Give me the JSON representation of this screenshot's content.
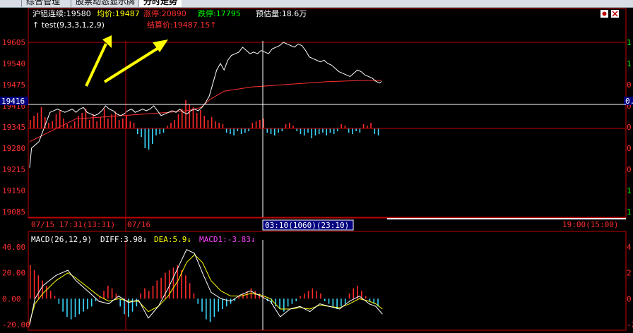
{
  "tabs": [
    {
      "label": "综合管理"
    },
    {
      "label": "股票动态显示牌"
    },
    {
      "label": "分时走势"
    }
  ],
  "info_bar": {
    "name": "沪铝连续:19580",
    "avg_label": "均价:19487",
    "up_limit": "涨停:20890",
    "down_limit": "跌停:17795",
    "est_vol": "预估量:18.6万",
    "indicator": "↑ test(9,3,3,1,2,9)",
    "settle": "结算价:19487.15↑",
    "corner_icon_a": "gear-icon",
    "corner_icon_b": "close-icon"
  },
  "price_axis": {
    "ticks": [
      "19605",
      "19540",
      "19475",
      "19410",
      "19345",
      "19280",
      "19215",
      "19150",
      "19085"
    ],
    "current": "19416",
    "ref": "19345"
  },
  "right_axis": {
    "current": "0.",
    "ticks": [
      "1",
      "1",
      "0",
      "0",
      "0",
      "0",
      "0",
      "1",
      "1"
    ]
  },
  "time_bar": {
    "left": "07/15  17:31(13:31)",
    "mid": "07/16",
    "cursor": "03:10(1060)(23:10)",
    "right": "19:00(15:00)"
  },
  "macd": {
    "label": "MACD(26,12,9)",
    "diff": "DIFF:3.98↓",
    "dea": "DEA:5.9↓",
    "macd1": "MACD1:-3.83↓",
    "ticks": [
      "40.00",
      "20.00",
      "0.00",
      "-20.00"
    ],
    "right_ticks": [
      "4",
      "2",
      "0",
      "-2"
    ]
  },
  "colors": {
    "up": "#ff2a2a",
    "down": "#3cd8ff",
    "frame": "#c00000",
    "avg": "#ff3030",
    "diff": "#ffffff",
    "dea": "#ffff00"
  },
  "chart_data": {
    "type": "line",
    "x_label": "time",
    "y_range": [
      19085,
      19605
    ],
    "price": [
      [
        0,
        19220
      ],
      [
        2,
        19280
      ],
      [
        6,
        19290
      ],
      [
        10,
        19300
      ],
      [
        14,
        19330
      ],
      [
        18,
        19360
      ],
      [
        22,
        19390
      ],
      [
        26,
        19395
      ],
      [
        30,
        19400
      ],
      [
        34,
        19395
      ],
      [
        38,
        19390
      ],
      [
        42,
        19395
      ],
      [
        46,
        19400
      ],
      [
        50,
        19390
      ],
      [
        54,
        19400
      ],
      [
        58,
        19405
      ],
      [
        62,
        19390
      ],
      [
        66,
        19385
      ],
      [
        70,
        19380
      ],
      [
        74,
        19385
      ],
      [
        78,
        19395
      ],
      [
        82,
        19410
      ],
      [
        86,
        19400
      ],
      [
        90,
        19395
      ],
      [
        94,
        19385
      ],
      [
        98,
        19380
      ],
      [
        102,
        19385
      ],
      [
        106,
        19395
      ],
      [
        110,
        19400
      ],
      [
        114,
        19390
      ],
      [
        118,
        19395
      ],
      [
        122,
        19400
      ],
      [
        126,
        19395
      ],
      [
        130,
        19400
      ],
      [
        134,
        19410
      ],
      [
        138,
        19395
      ],
      [
        142,
        19380
      ],
      [
        146,
        19385
      ],
      [
        150,
        19390
      ],
      [
        154,
        19395
      ],
      [
        158,
        19390
      ],
      [
        162,
        19400
      ],
      [
        166,
        19390
      ],
      [
        170,
        19385
      ],
      [
        174,
        19395
      ],
      [
        178,
        19400
      ],
      [
        182,
        19395
      ],
      [
        186,
        19405
      ],
      [
        190,
        19420
      ],
      [
        194,
        19440
      ],
      [
        198,
        19480
      ],
      [
        202,
        19520
      ],
      [
        206,
        19540
      ],
      [
        210,
        19520
      ],
      [
        214,
        19550
      ],
      [
        218,
        19565
      ],
      [
        222,
        19570
      ],
      [
        226,
        19575
      ],
      [
        230,
        19590
      ],
      [
        234,
        19580
      ],
      [
        238,
        19570
      ],
      [
        242,
        19575
      ],
      [
        246,
        19570
      ],
      [
        250,
        19580
      ],
      [
        254,
        19575
      ],
      [
        258,
        19570
      ],
      [
        262,
        19585
      ],
      [
        266,
        19590
      ],
      [
        270,
        19595
      ],
      [
        274,
        19605
      ],
      [
        278,
        19600
      ],
      [
        282,
        19595
      ],
      [
        286,
        19590
      ],
      [
        290,
        19600
      ],
      [
        294,
        19595
      ],
      [
        298,
        19580
      ],
      [
        302,
        19560
      ],
      [
        306,
        19555
      ],
      [
        310,
        19550
      ],
      [
        314,
        19545
      ],
      [
        318,
        19550
      ],
      [
        322,
        19540
      ],
      [
        326,
        19535
      ],
      [
        330,
        19525
      ],
      [
        334,
        19515
      ],
      [
        338,
        19510
      ],
      [
        342,
        19505
      ],
      [
        346,
        19500
      ],
      [
        350,
        19510
      ],
      [
        354,
        19520
      ],
      [
        358,
        19515
      ],
      [
        362,
        19505
      ],
      [
        366,
        19500
      ],
      [
        370,
        19495
      ],
      [
        374,
        19485
      ],
      [
        378,
        19480
      ],
      [
        380,
        19485
      ]
    ],
    "avg": [
      [
        0,
        19300
      ],
      [
        50,
        19370
      ],
      [
        100,
        19380
      ],
      [
        150,
        19390
      ],
      [
        170,
        19395
      ],
      [
        185,
        19405
      ],
      [
        195,
        19430
      ],
      [
        210,
        19455
      ],
      [
        240,
        19468
      ],
      [
        280,
        19476
      ],
      [
        320,
        19484
      ],
      [
        360,
        19488
      ],
      [
        380,
        19488
      ]
    ],
    "flow_bars": [
      12,
      18,
      22,
      30,
      16,
      8,
      10,
      20,
      25,
      14,
      6,
      4,
      10,
      18,
      22,
      28,
      12,
      20,
      10,
      16,
      28,
      14,
      20,
      24,
      12,
      14,
      18,
      10,
      8,
      -8,
      -12,
      -28,
      -30,
      -22,
      -10,
      -8,
      -6,
      4,
      8,
      12,
      20,
      28,
      40,
      34,
      30,
      22,
      26,
      18,
      12,
      16,
      10,
      8,
      6,
      -6,
      -8,
      -10,
      -4,
      -8,
      -6,
      -4,
      8,
      10,
      12,
      14,
      -6,
      -8,
      -10,
      -6,
      -4,
      6,
      8,
      4,
      -4,
      -8,
      -10,
      -6,
      -14,
      -10,
      -8,
      -6,
      -10,
      -6,
      -8,
      -4,
      6,
      4,
      -6,
      -8,
      -4,
      -6,
      6,
      4,
      8,
      -8,
      -10
    ],
    "macd_bars": [
      26,
      22,
      18,
      14,
      10,
      6,
      2,
      -4,
      -10,
      -14,
      -16,
      -14,
      -12,
      -10,
      -8,
      -6,
      -2,
      2,
      6,
      10,
      8,
      4,
      -6,
      -12,
      -14,
      -10,
      -6,
      4,
      8,
      6,
      10,
      14,
      16,
      20,
      22,
      24,
      26,
      22,
      18,
      12,
      4,
      -4,
      -10,
      -16,
      -18,
      -14,
      -10,
      -8,
      -6,
      -4,
      -2,
      2,
      4,
      6,
      8,
      6,
      4,
      2,
      -2,
      -4,
      -6,
      -8,
      -10,
      -6,
      -4,
      -2,
      2,
      4,
      6,
      8,
      6,
      4,
      -2,
      -4,
      -6,
      -8,
      -6,
      -4,
      4,
      8,
      10,
      6,
      2,
      -2,
      -4,
      -6
    ],
    "diff_line": [
      [
        0,
        -20
      ],
      [
        8,
        0
      ],
      [
        20,
        10
      ],
      [
        40,
        18
      ],
      [
        58,
        22
      ],
      [
        70,
        14
      ],
      [
        90,
        5
      ],
      [
        105,
        -2
      ],
      [
        120,
        -4
      ],
      [
        135,
        2
      ],
      [
        150,
        -3
      ],
      [
        165,
        -1
      ],
      [
        180,
        -15
      ],
      [
        195,
        -6
      ],
      [
        210,
        8
      ],
      [
        225,
        24
      ],
      [
        238,
        38
      ],
      [
        250,
        35
      ],
      [
        262,
        20
      ],
      [
        275,
        5
      ],
      [
        290,
        0
      ],
      [
        305,
        -2
      ],
      [
        320,
        3
      ],
      [
        335,
        6
      ],
      [
        350,
        2
      ],
      [
        365,
        -2
      ],
      [
        380,
        -14
      ],
      [
        395,
        -8
      ],
      [
        410,
        -6
      ],
      [
        425,
        -10
      ],
      [
        440,
        -4
      ],
      [
        455,
        -6
      ],
      [
        470,
        -8
      ],
      [
        485,
        -2
      ],
      [
        500,
        2
      ],
      [
        515,
        -4
      ],
      [
        525,
        -6
      ],
      [
        535,
        -12
      ]
    ],
    "dea_line": [
      [
        0,
        -18
      ],
      [
        8,
        -4
      ],
      [
        20,
        4
      ],
      [
        40,
        14
      ],
      [
        58,
        20
      ],
      [
        70,
        16
      ],
      [
        90,
        8
      ],
      [
        105,
        2
      ],
      [
        120,
        -2
      ],
      [
        135,
        0
      ],
      [
        150,
        -2
      ],
      [
        165,
        -2
      ],
      [
        180,
        -10
      ],
      [
        195,
        -6
      ],
      [
        210,
        2
      ],
      [
        225,
        14
      ],
      [
        238,
        28
      ],
      [
        250,
        34
      ],
      [
        262,
        28
      ],
      [
        275,
        14
      ],
      [
        290,
        6
      ],
      [
        305,
        2
      ],
      [
        320,
        2
      ],
      [
        335,
        4
      ],
      [
        350,
        3
      ],
      [
        365,
        0
      ],
      [
        380,
        -8
      ],
      [
        395,
        -8
      ],
      [
        410,
        -7
      ],
      [
        425,
        -8
      ],
      [
        440,
        -5
      ],
      [
        455,
        -6
      ],
      [
        470,
        -7
      ],
      [
        485,
        -4
      ],
      [
        500,
        0
      ],
      [
        515,
        -2
      ],
      [
        525,
        -4
      ],
      [
        535,
        -8
      ]
    ]
  }
}
